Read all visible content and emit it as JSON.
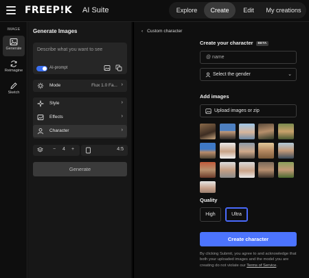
{
  "app": {
    "logo": "FREEP!K",
    "suite": "AI Suite"
  },
  "nav": {
    "explore": "Explore",
    "create": "Create",
    "edit": "Edit",
    "my_creations": "My creations",
    "active": "Create"
  },
  "rail": {
    "title": "IMAGE",
    "items": [
      {
        "label": "Generate",
        "icon": "image-icon",
        "active": true
      },
      {
        "label": "Reimagine",
        "icon": "refresh-icon",
        "active": false
      },
      {
        "label": "Sketch",
        "icon": "pencil-icon",
        "active": false
      }
    ]
  },
  "panel": {
    "title": "Generate Images",
    "prompt_placeholder": "Describe what you want to see",
    "ai_prompt_label": "AI-prompt",
    "ai_prompt_enabled": true,
    "mode_label": "Mode",
    "mode_value": "Flux 1.0 Fa...",
    "style_label": "Style",
    "effects_label": "Effects",
    "character_label": "Character",
    "count_minus": "−",
    "count_value": "4",
    "count_plus": "+",
    "ratio_value": "4:5",
    "generate_label": "Generate"
  },
  "right": {
    "breadcrumb": "Custom character",
    "create_title": "Create your character",
    "beta_badge": "BETA",
    "name_placeholder": "@ name",
    "gender_placeholder": "Select the gender",
    "add_images_title": "Add images",
    "upload_label": "Upload images or zip",
    "quality_title": "Quality",
    "quality_options": [
      "High",
      "Ultra"
    ],
    "quality_selected": "Ultra",
    "create_button": "Create character",
    "terms_text": "By clicking Submit, you agree to and acknowledge that both your uploaded images and the model you are creating do not violate our ",
    "terms_link": "Terms of Service",
    "terms_end": "."
  },
  "colors": {
    "accent": "#4c74ff",
    "toggle": "#3a6ff0",
    "background": "#0e0e0e",
    "panel": "#171717"
  }
}
